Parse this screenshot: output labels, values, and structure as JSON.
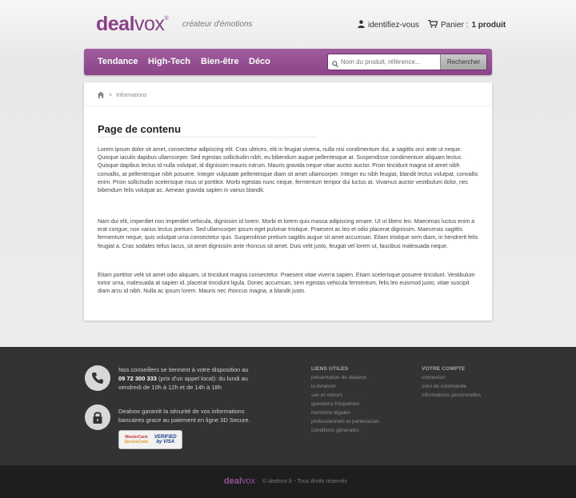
{
  "header": {
    "logo_deal": "deal",
    "logo_vox": "vox",
    "logo_mark": "®",
    "tagline": "créateur d'émotions",
    "account_link": "identifiez-vous",
    "cart_label": "Panier :",
    "cart_count": "1 produit"
  },
  "nav": {
    "items": [
      "Tendance",
      "High-Tech",
      "Bien-être",
      "Déco"
    ],
    "search_placeholder": "Nom du produit, référence...",
    "search_button": "Rechercher"
  },
  "breadcrumb": {
    "sep": ">",
    "current": "Informations"
  },
  "content": {
    "title": "Page de contenu",
    "paragraphs": [
      "Lorem ipsum dolor sit amet, consectetur adipiscing elit. Cras ultrices, elit in feugiat viverra, nulla nisi condimentum dui, a sagittis orci ante ut neque. Quisque iaculis dapibus ullamcorper. Sed egestas sollicitudin nibh, eu bibendum augue pellentesque at. Suspendisse condimentum aliquam lectus. Quisque dapibus lectus id nulla volutpat, id dignissim mauris rutrum. Mauris gravida neque vitae auctor auctor. Proin tincidunt magna sit amet nibh convallis, at pellentesque nibh posuere. Integer vulputate pellentesque diam sit amet ullamcorper. Integer eu nibh feugiat, blandit lectus volutpat, convallis enim. Proin sollicitudin scelerisque risus ut porttitor. Morbi egestas nunc neque, fermentum tempor dui luctus at. Vivamus auctor vestibulum dolor, nec bibendum felis volutpat ac. Aenean gravida sapien in varius blandit.",
      "Nam dui elit, imperdiet non imperdiet vehicula, dignissim id lorem. Morbi et lorem quis massa adipiscing ornare. Ut ut libero leo. Maecenas luctus enim a erat congue, non varius lectus pretium. Sed ullamcorper ipsum eget pulvinar tristique. Praesent ac leo et odio placerat dignissim. Maecenas sagittis fermentum neque, quis volutpat urna consectetur quis. Suspendisse pretium sagittis augue sit amet accumsan. Etiam tristique sem diam, in hendrerit felis feugiat a. Cras sodales tellus lacus, sit amet dignissim ante rhoncus sit amet. Duis velit justo, feugiat vel lorem ut, faucibus malesuada neque.",
      "Etiam porttitor velit sit amet odio aliquam, ut tincidunt magna consectetur. Praesent vitae viverra sapien. Etiam scelerisque posuere tincidunt. Vestibulum tortor urna, malesuada at sapien id, placerat tincidunt ligula. Donec accumsan, sem egestas vehicula fermentum, felis leo euismod justo, vitae suscipit diam arcu id nibh. Nulla ac ipsum lorem. Mauris nec rhoncus magna, a blandit justo."
    ]
  },
  "footer": {
    "phone_line1": "Nos conseillers se tiennent à votre disposition au",
    "phone_number": "09 72 300 333",
    "phone_line2": " (prix d'un appel local): du lundi au",
    "phone_line3": "vendredi de 10h à 12h et de 14h à 18h",
    "secure_line1": "Dealvox garantit la sécurité de vos informations",
    "secure_line2": "bancaires grace au paiement en ligne 3D Secure.",
    "mastercard_1": "MasterCard.",
    "mastercard_2": "SecureCode.",
    "visa_1": "VERIFIED",
    "visa_2": "by VISA",
    "useful_title": "LIENS UTILES",
    "useful_links": [
      "présentation de dealvox",
      "la livraison",
      "sav et retours",
      "questions fréquentes",
      "mentions légales",
      "professionnels et partenariats",
      "conditions générales"
    ],
    "account_title": "VOTRE COMPTE",
    "account_links": [
      "connexion",
      "suivi de commande",
      "informations personnelles"
    ]
  },
  "bottom": {
    "logo_deal": "deal",
    "logo_vox": "vox",
    "copyright": "© dealvox.fr - Tous droits réservés"
  },
  "colors": {
    "brand": "#8a4388",
    "footer": "#333333",
    "bottom": "#1e1e1e"
  }
}
